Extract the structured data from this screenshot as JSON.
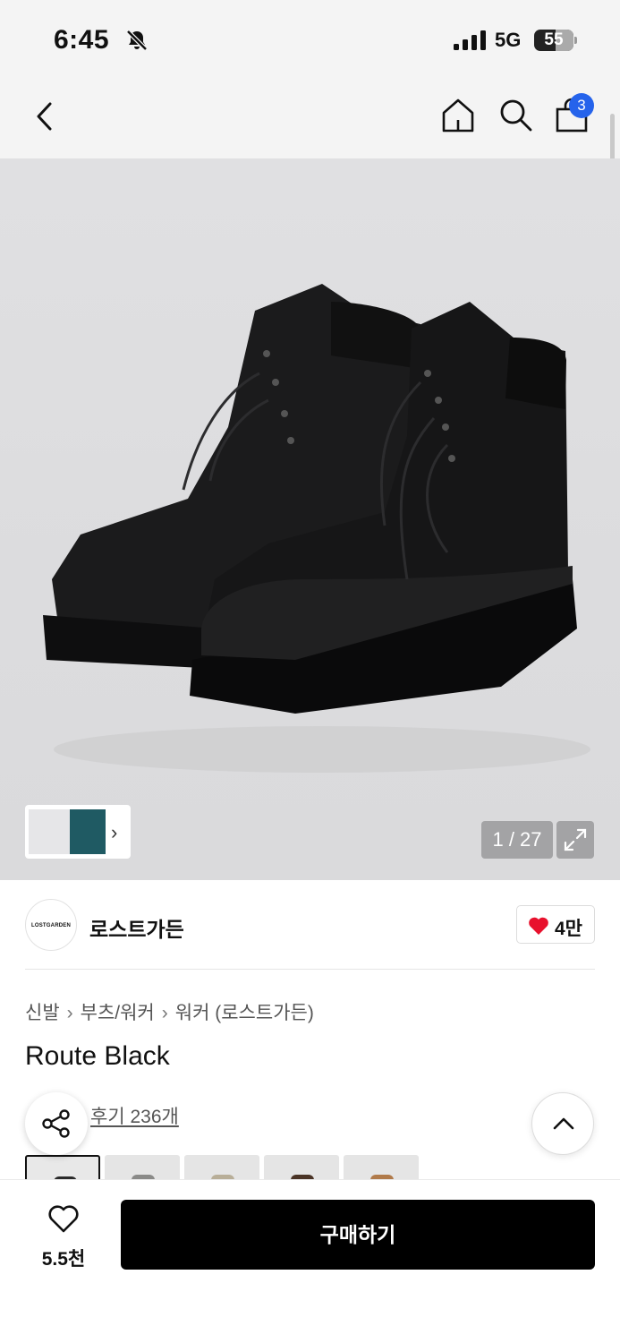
{
  "status_bar": {
    "time": "6:45",
    "network": "5G",
    "battery_level": "55",
    "icons": [
      "bell-slash-icon",
      "signal-icon",
      "battery-icon"
    ]
  },
  "nav": {
    "cart_count": "3",
    "icons": [
      "back-icon",
      "home-icon",
      "search-icon",
      "shopping-bag-icon"
    ]
  },
  "gallery": {
    "counter": "1 / 27",
    "thumb_next": "›",
    "icons": [
      "expand-icon"
    ]
  },
  "brand": {
    "logo_text": "LOSTGARDEN",
    "name": "로스트가든",
    "likes": "4만",
    "heart_color": "#e8112d"
  },
  "breadcrumb": {
    "items": [
      "신발",
      "부츠/워커",
      "워커 (로스트가든)"
    ],
    "separator": "›"
  },
  "product": {
    "title": "Route Black",
    "reviews": "후기 236개"
  },
  "color_options": [
    {
      "swatch": "#2a2a2a",
      "selected": true
    },
    {
      "swatch": "#8a8a88",
      "selected": false
    },
    {
      "swatch": "#b8ae98",
      "selected": false
    },
    {
      "swatch": "#4a3426",
      "selected": false
    },
    {
      "swatch": "#b07a4a",
      "selected": false
    }
  ],
  "bottom_bar": {
    "wishlist_count": "5.5천",
    "buy_label": "구매하기"
  },
  "colors": {
    "accent_blue": "#2563eb",
    "buy_button": "#000000"
  }
}
